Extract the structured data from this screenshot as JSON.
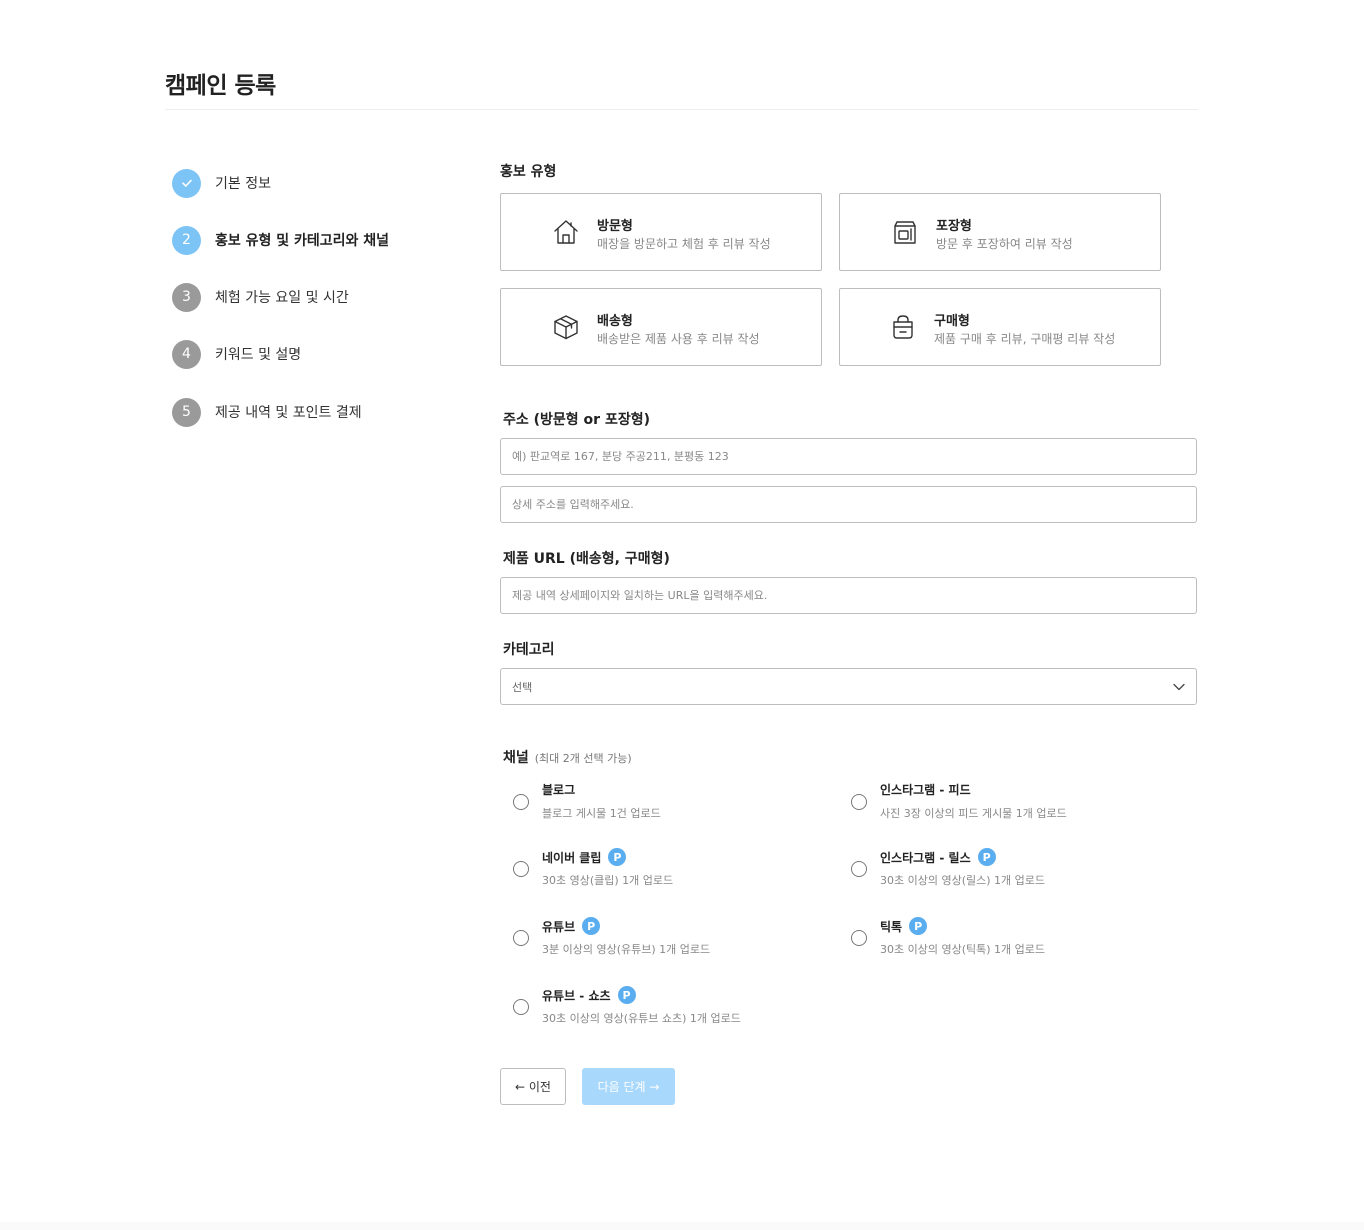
{
  "page": {
    "title": "캠페인 등록"
  },
  "steps": [
    {
      "number": "✓",
      "label": "기본 정보",
      "state": "done"
    },
    {
      "number": "2",
      "label": "홍보 유형 및 카테고리와 채널",
      "state": "active"
    },
    {
      "number": "3",
      "label": "체험 가능 요일 및 시간",
      "state": "pending"
    },
    {
      "number": "4",
      "label": "키워드 및 설명",
      "state": "pending"
    },
    {
      "number": "5",
      "label": "제공 내역 및 포인트 결제",
      "state": "pending"
    }
  ],
  "promo_type": {
    "label": "홍보 유형",
    "options": [
      {
        "icon": "house-icon",
        "title": "방문형",
        "desc": "매장을 방문하고 체험 후 리뷰 작성"
      },
      {
        "icon": "takeout-bag-icon",
        "title": "포장형",
        "desc": "방문 후 포장하여 리뷰 작성"
      },
      {
        "icon": "box-icon",
        "title": "배송형",
        "desc": "배송받은 제품 사용 후 리뷰 작성"
      },
      {
        "icon": "shopping-bag-icon",
        "title": "구매형",
        "desc": "제품 구매 후 리뷰, 구매평 리뷰 작성"
      }
    ]
  },
  "address": {
    "label": "주소 (방문형 or 포장형)",
    "placeholder": "예) 판교역로 167, 분당 주공211, 분평동 123",
    "detail_placeholder": "상세 주소를 입력해주세요."
  },
  "product_url": {
    "label": "제품 URL (배송형, 구매형)",
    "placeholder": "제공 내역 상세페이지와 일치하는 URL을 입력해주세요."
  },
  "category": {
    "label": "카테고리",
    "selected": "선택"
  },
  "channel": {
    "label": "채널",
    "sub_label": "(최대 2개 선택 가능)",
    "options": [
      {
        "title": "블로그",
        "desc": "블로그 게시물 1건 업로드",
        "badge": ""
      },
      {
        "title": "인스타그램 - 피드",
        "desc": "사진 3장 이상의 피드 게시물 1개 업로드",
        "badge": ""
      },
      {
        "title": "네이버 클립",
        "desc": "30초 영상(클립) 1개 업로드",
        "badge": "P"
      },
      {
        "title": "인스타그램 - 릴스",
        "desc": "30초 이상의 영상(릴스) 1개 업로드",
        "badge": "P"
      },
      {
        "title": "유튜브",
        "desc": "3분 이상의 영상(유튜브) 1개 업로드",
        "badge": "P"
      },
      {
        "title": "틱톡",
        "desc": "30초 이상의 영상(틱톡) 1개 업로드",
        "badge": "P"
      },
      {
        "title": "유튜브 - 쇼츠",
        "desc": "30초 이상의 영상(유튜브 쇼츠) 1개 업로드",
        "badge": "P"
      }
    ]
  },
  "buttons": {
    "prev_label": "← 이전",
    "next_label": "다음 단계 →"
  },
  "colors": {
    "accent": "#7cc4f5",
    "badge": "#5aaef0",
    "next_button_disabled": "#a8d8fb",
    "pending_step": "#9a9a9a"
  }
}
